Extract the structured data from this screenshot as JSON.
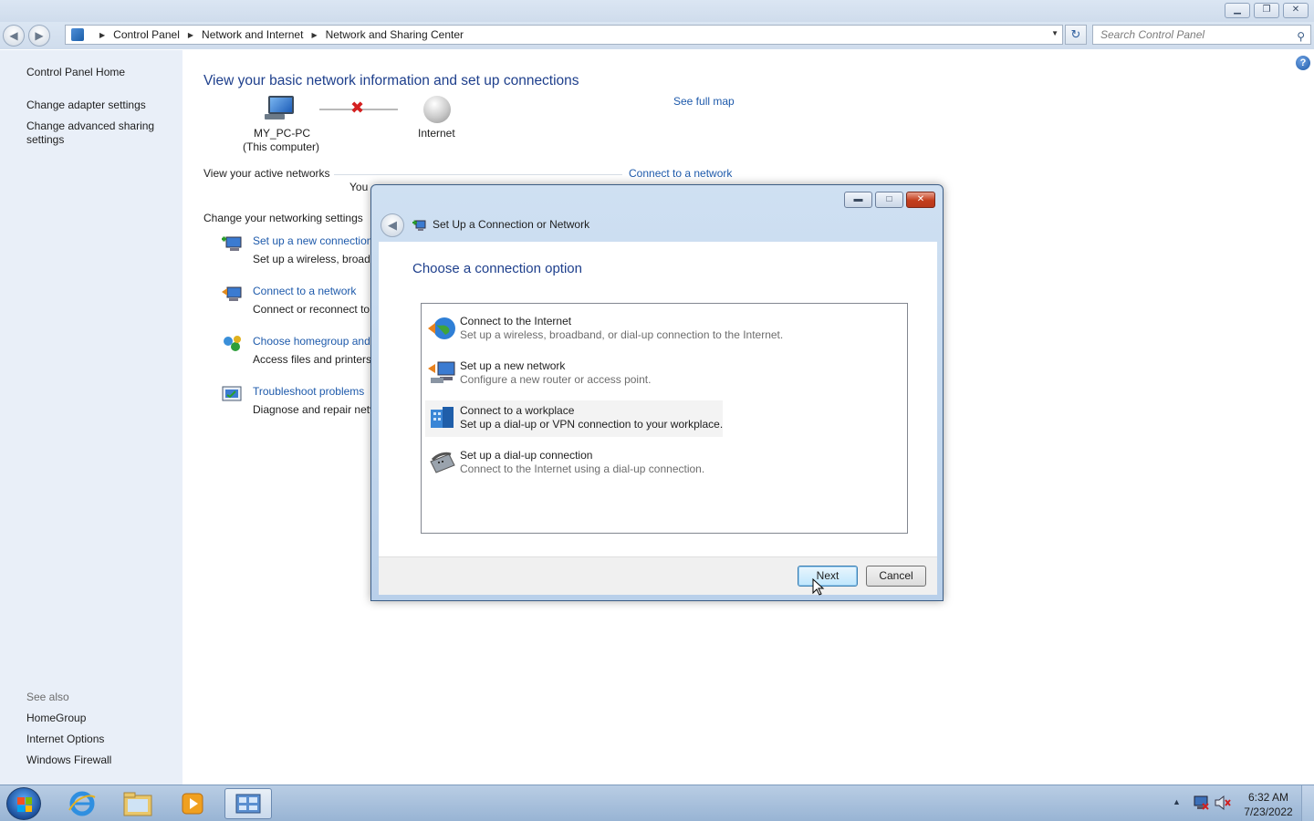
{
  "titlebar": {
    "min": "▁",
    "restore": "❐",
    "close": "✕"
  },
  "address": {
    "breadcrumbs": [
      "Control Panel",
      "Network and Internet",
      "Network and Sharing Center"
    ],
    "search_placeholder": "Search Control Panel"
  },
  "sidebar": {
    "home": "Control Panel Home",
    "links": [
      "Change adapter settings",
      "Change advanced sharing settings"
    ],
    "see_also_heading": "See also",
    "see_also": [
      "HomeGroup",
      "Internet Options",
      "Windows Firewall"
    ]
  },
  "main": {
    "title": "View your basic network information and set up connections",
    "see_full_map": "See full map",
    "computer_name": "MY_PC-PC",
    "computer_sub": "(This computer)",
    "internet_label": "Internet",
    "active_networks_label": "View your active networks",
    "connect_link": "Connect to a network",
    "partial_you": "You",
    "settings_heading": "Change your networking settings",
    "tasks": [
      {
        "link": "Set up a new connection",
        "desc": "Set up a wireless, broadb"
      },
      {
        "link": "Connect to a network",
        "desc": "Connect or reconnect to"
      },
      {
        "link": "Choose homegroup and",
        "desc": "Access files and printers"
      },
      {
        "link": "Troubleshoot problems",
        "desc": "Diagnose and repair netv"
      }
    ]
  },
  "dialog": {
    "title": "Set Up a Connection or Network",
    "heading": "Choose a connection option",
    "options": [
      {
        "title": "Connect to the Internet",
        "desc": "Set up a wireless, broadband, or dial-up connection to the Internet."
      },
      {
        "title": "Set up a new network",
        "desc": "Configure a new router or access point."
      },
      {
        "title": "Connect to a workplace",
        "desc": "Set up a dial-up or VPN connection to your workplace."
      },
      {
        "title": "Set up a dial-up connection",
        "desc": "Connect to the Internet using a dial-up connection."
      }
    ],
    "selected_index": 2,
    "next_label": "Next",
    "cancel_label": "Cancel"
  },
  "taskbar": {
    "time": "6:32 AM",
    "date": "7/23/2022"
  }
}
